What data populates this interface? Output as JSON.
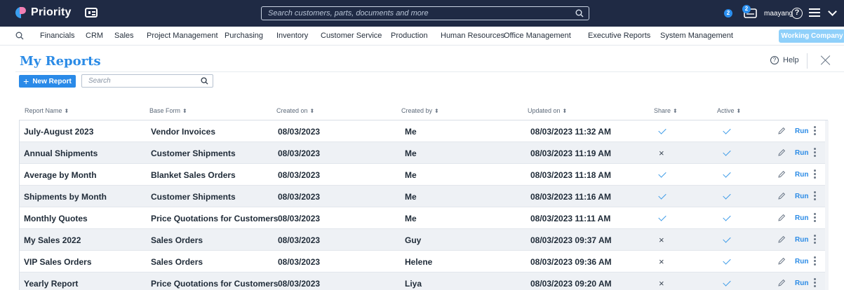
{
  "app": {
    "name": "Priority",
    "search_placeholder": "Search customers, parts, documents and more",
    "notif_count_1": "2",
    "notif_count_2": "2",
    "username": "maayang",
    "help_glyph": "?"
  },
  "menu": {
    "items": [
      "Financials",
      "CRM",
      "Sales",
      "Project Management",
      "Purchasing",
      "Inventory",
      "Customer Service",
      "Production",
      "Human Resources",
      "Office Management",
      "Executive Reports",
      "System Management"
    ],
    "working_company": "Working Company"
  },
  "page": {
    "title": "My Reports",
    "help_label": "Help",
    "new_report_label": "New Report",
    "search_placeholder": "Search"
  },
  "table": {
    "columns": [
      "Report Name",
      "Base Form",
      "Created on",
      "Created by",
      "Updated on",
      "Share",
      "Active"
    ],
    "run_label": "Run",
    "rows": [
      {
        "name": "July-August 2023",
        "form": "Vendor Invoices",
        "created_on": "08/03/2023",
        "created_by": "Me",
        "updated_on": "08/03/2023 11:32 AM",
        "share": true,
        "active": true
      },
      {
        "name": "Annual Shipments",
        "form": "Customer Shipments",
        "created_on": "08/03/2023",
        "created_by": "Me",
        "updated_on": "08/03/2023 11:19 AM",
        "share": false,
        "active": true
      },
      {
        "name": "Average by Month",
        "form": "Blanket Sales Orders",
        "created_on": "08/03/2023",
        "created_by": "Me",
        "updated_on": "08/03/2023 11:18 AM",
        "share": true,
        "active": true
      },
      {
        "name": "Shipments by Month",
        "form": "Customer Shipments",
        "created_on": "08/03/2023",
        "created_by": "Me",
        "updated_on": "08/03/2023 11:16 AM",
        "share": true,
        "active": true
      },
      {
        "name": "Monthly Quotes",
        "form": "Price Quotations for Customers",
        "created_on": "08/03/2023",
        "created_by": "Me",
        "updated_on": "08/03/2023 11:11 AM",
        "share": true,
        "active": true
      },
      {
        "name": "My Sales 2022",
        "form": "Sales Orders",
        "created_on": "08/03/2023",
        "created_by": "Guy",
        "updated_on": "08/03/2023 09:37 AM",
        "share": false,
        "active": true
      },
      {
        "name": "VIP Sales Orders",
        "form": "Sales Orders",
        "created_on": "08/03/2023",
        "created_by": "Helene",
        "updated_on": "08/03/2023 09:36 AM",
        "share": false,
        "active": true
      },
      {
        "name": "Yearly Report",
        "form": "Price Quotations for Customers",
        "created_on": "08/03/2023",
        "created_by": "Liya",
        "updated_on": "08/03/2023 09:20 AM",
        "share": false,
        "active": true
      }
    ]
  },
  "colors": {
    "topbar": "#1f2a44",
    "accent": "#2b8be6",
    "check": "#3a9ae8",
    "working_company_bg": "#8fd0fa"
  }
}
